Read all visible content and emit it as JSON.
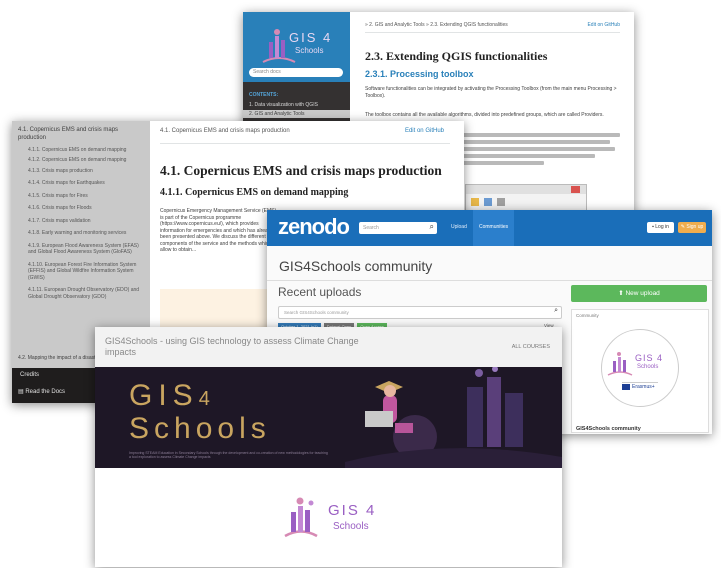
{
  "qgis": {
    "breadcrumb": "» 2. GIS and Analytic Tools » 2.3. Extending QGIS functionalities",
    "edit_link": "Edit on GitHub",
    "logo_text": "GIS 4",
    "logo_sub": "Schools",
    "search_placeholder": "Search docs",
    "contents_label": "CONTENTS:",
    "nav": [
      "1. Data visualization with QGIS",
      "2. GIS and Analytic Tools"
    ],
    "heading": "2.3. Extending QGIS functionalities",
    "subheading": "2.3.1. Processing toolbox",
    "para1": "Software functionalities can be integrated by activating the Processing Toolbox (from the main menu Processing > Toolbox).",
    "para2": "The toolbox contains all the available algorithms, divided into predefined groups, which are called Providers."
  },
  "ems": {
    "breadcrumb": "4.1. Copernicus EMS and crisis maps production",
    "edit_link": "Edit on GitHub",
    "sidebar_items": [
      "4.1. Copernicus EMS and crisis maps production",
      "4.1.1. Copernicus EMS on demand mapping",
      "4.1.2. Copernicus EMS on demand mapping",
      "4.1.3. Crisis maps production",
      "4.1.4. Crisis maps for Earthquakes",
      "4.1.5. Crisis maps for Fires",
      "4.1.6. Crisis maps for Floods",
      "4.1.7. Crisis maps validation",
      "4.1.8. Early warning and monitoring services",
      "4.1.9. European Flood Awareness System (EFAS) and Global Flood Awareness System (GloFAS)",
      "4.1.10. European Forest Fire Information System (EFFIS) and Global Wildfire Information System (GWIS)",
      "4.1.11. European Drought Observatory (EDO) and Global Drought Observatory (GDO)"
    ],
    "last_item": "4.2. Mapping the impact of a disaster",
    "credits": "Credits",
    "read_docs": "Read the Docs",
    "heading": "4.1. Copernicus EMS and crisis maps production",
    "subheading": "4.1.1. Copernicus EMS on demand mapping",
    "para": "Copernicus Emergency Management Service (EMS) is part of the Copernicus programme (https://www.copernicus.eu/), which provides information for emergencies and which has already been presented above. We discuss the different components of the service and the methods which allow to obtain..."
  },
  "zenodo": {
    "logo": "zenodo",
    "search_placeholder": "Search",
    "nav": [
      "Upload",
      "Communities"
    ],
    "login": "Log in",
    "signup": "Sign up",
    "community_title": "GIS4Schools community",
    "recent_uploads": "Recent uploads",
    "search_community": "Search GIS4Schools community",
    "badges": [
      "October 1, 2021 (v1)",
      "Dataset Open",
      "Open Access"
    ],
    "view": "View",
    "new_upload": "New upload",
    "community_label": "Community",
    "community_name": "GIS4Schools community",
    "erasmus": "Erasmus+"
  },
  "course": {
    "title": "GIS4Schools - using GIS technology to assess Climate Change impacts",
    "all_courses": "ALL COURSES",
    "banner_line1": "GIS",
    "banner_num": "4",
    "banner_line2": "Schools",
    "banner_tagline": "Improving STEAM Education in Secondary Schools through the development and co-creation of new methodologies for teaching a tool exploration to assess Climate Change impacts",
    "logo_text": "GIS 4",
    "logo_sub": "Schools"
  },
  "colors": {
    "rtd_sidebar": "#343131",
    "rtd_link": "#2980b9",
    "zenodo_blue": "#1a6eb9",
    "zenodo_green": "#5cb85c",
    "signup_orange": "#f0ad4e",
    "logo_purple": "#9a5fc3",
    "logo_pink": "#d68ab4",
    "banner_dark": "#1e1726",
    "banner_gold": "#c9a560"
  }
}
